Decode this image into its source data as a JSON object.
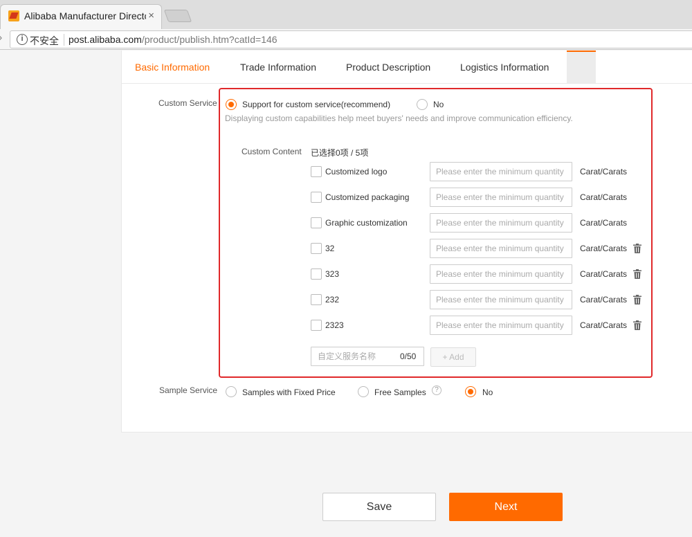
{
  "browser": {
    "tab_title": "Alibaba Manufacturer Directory",
    "tab_close": "×",
    "security_label": "不安全",
    "url_host": "post.alibaba.com",
    "url_path": "/product/publish.htm?catId=146"
  },
  "section_tabs": [
    {
      "label": "Basic Information",
      "active": true
    },
    {
      "label": "Trade Information",
      "active": false
    },
    {
      "label": "Product Description",
      "active": false
    },
    {
      "label": "Logistics Information",
      "active": false
    }
  ],
  "custom_service": {
    "label": "Custom Service",
    "option_support": "Support for custom service(recommend)",
    "option_no": "No",
    "selected": "support",
    "hint": "Displaying custom capabilities help meet buyers' needs and improve communication efficiency.",
    "content_label": "Custom Content",
    "selected_count": "已选择0项 / 5项",
    "items": [
      {
        "name": "Customized logo",
        "placeholder": "Please enter the minimum quantity",
        "unit": "Carat/Carats",
        "deletable": false
      },
      {
        "name": "Customized packaging",
        "placeholder": "Please enter the minimum quantity",
        "unit": "Carat/Carats",
        "deletable": false
      },
      {
        "name": "Graphic customization",
        "placeholder": "Please enter the minimum quantity",
        "unit": "Carat/Carats",
        "deletable": false
      },
      {
        "name": "32",
        "placeholder": "Please enter the minimum quantity",
        "unit": "Carat/Carats",
        "deletable": true
      },
      {
        "name": "323",
        "placeholder": "Please enter the minimum quantity",
        "unit": "Carat/Carats",
        "deletable": true
      },
      {
        "name": "232",
        "placeholder": "Please enter the minimum quantity",
        "unit": "Carat/Carats",
        "deletable": true
      },
      {
        "name": "2323",
        "placeholder": "Please enter the minimum quantity",
        "unit": "Carat/Carats",
        "deletable": true
      }
    ],
    "name_placeholder": "自定义服务名称",
    "name_counter": "0/50",
    "add_label": "+ Add"
  },
  "sample_service": {
    "label": "Sample Service",
    "options": [
      "Samples with Fixed Price",
      "Free Samples",
      "No"
    ],
    "selected": "No",
    "help_glyph": "?"
  },
  "footer": {
    "save_label": "Save",
    "next_label": "Next"
  },
  "colors": {
    "accent": "#ff6a00",
    "highlight_border": "#e0282a"
  }
}
